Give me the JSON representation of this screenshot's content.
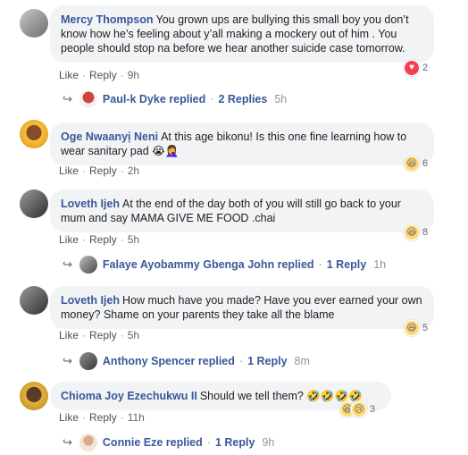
{
  "comments": [
    {
      "author": "Mercy Thompson",
      "text": "You grown ups are bullying this small boy you don’t know how he’s feeling about y’all making a mockery out of him . You people should stop na before we hear another suicide case tomorrow.",
      "like": "Like",
      "reply": "Reply",
      "time": "9h",
      "reaction_count": "2",
      "reaction_icon": "heart-icon",
      "replies": {
        "name": "Paul-k Dyke",
        "replied": "replied",
        "count": "2 Replies",
        "time": "5h"
      }
    },
    {
      "author": "Oge Nwaanyị Neni",
      "text": "At this age bikonu! Is this one fine learning how to wear sanitary pad 😭🤦‍♀️",
      "like": "Like",
      "reply": "Reply",
      "time": "2h",
      "reaction_count": "6",
      "reaction_icon": "laugh-icon"
    },
    {
      "author": "Loveth Ijeh",
      "text": "At the end of the day both of you will still go back to your mum and say MAMA GIVE ME FOOD .chai",
      "like": "Like",
      "reply": "Reply",
      "time": "5h",
      "reaction_count": "8",
      "reaction_icon": "laugh-icon",
      "replies": {
        "name": "Falaye Ayobammy Gbenga John",
        "replied": "replied",
        "count": "1 Reply",
        "time": "1h"
      }
    },
    {
      "author": "Loveth Ijeh",
      "text": "How much have you made? Have you ever earned your own money? Shame on your parents they take all the blame",
      "like": "Like",
      "reply": "Reply",
      "time": "5h",
      "reaction_count": "5",
      "reaction_icon": "laugh-icon",
      "replies": {
        "name": "Anthony Spencer",
        "replied": "replied",
        "count": "1 Reply",
        "time": "8m"
      }
    },
    {
      "author": "Chioma Joy Ezechukwu II",
      "text": "Should we tell them? 🤣🤣🤣🤣",
      "like": "Like",
      "reply": "Reply",
      "time": "11h",
      "reaction_count": "3",
      "reaction_icon": "laugh-icon",
      "reaction_icon_2": "sad-icon",
      "replies": {
        "name": "Connie Eze",
        "replied": "replied",
        "count": "1 Reply",
        "time": "9h"
      }
    }
  ],
  "colors": {
    "link": "#385898",
    "bubble": "#f2f3f5",
    "meta": "#606770"
  }
}
